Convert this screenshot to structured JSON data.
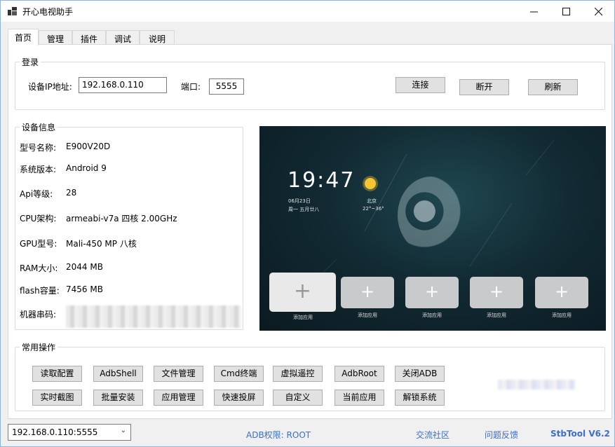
{
  "window": {
    "title": "开心电视助手"
  },
  "icons": {
    "app": "app-icon",
    "minimize": "minimize-icon",
    "maximize": "maximize-icon",
    "close": "close-icon",
    "dropdown": "chevron-down-icon",
    "sun": "sun-icon",
    "plus": "plus-icon"
  },
  "tabs": [
    {
      "label": "首页",
      "active": true
    },
    {
      "label": "管理"
    },
    {
      "label": "插件"
    },
    {
      "label": "调试"
    },
    {
      "label": "说明"
    }
  ],
  "login": {
    "legend": "登录",
    "ip_label": "设备IP地址:",
    "ip_value": "192.168.0.110",
    "port_label": "端口:",
    "port_value": "5555",
    "connect": "连接",
    "disconnect": "断开",
    "refresh": "刷新"
  },
  "device": {
    "legend": "设备信息",
    "rows": [
      {
        "label": "型号名称:",
        "value": "E900V20D"
      },
      {
        "label": "系统版本:",
        "value": "Android 9"
      },
      {
        "label": "Api等级:",
        "value": "28"
      },
      {
        "label": "CPU架构:",
        "value": "armeabi-v7a 四核 2.00GHz"
      },
      {
        "label": "GPU型号:",
        "value": "Mali-450 MP 八核"
      },
      {
        "label": "RAM大小:",
        "value": "2044 MB"
      },
      {
        "label": "flash容量:",
        "value": "7456 MB"
      },
      {
        "label": "机器串码:",
        "value": ""
      }
    ]
  },
  "tv": {
    "time": "19:47",
    "date": "06月23日",
    "weekday": "周一 五月廿八",
    "city": "北京",
    "temp": "22°~36°",
    "tiles": [
      "添加应用",
      "添加应用",
      "添加应用",
      "添加应用",
      "添加应用"
    ]
  },
  "ops": {
    "legend": "常用操作",
    "row1": [
      "读取配置",
      "AdbShell",
      "文件管理",
      "Cmd终端",
      "虚拟遥控",
      "AdbRoot",
      "关闭ADB"
    ],
    "row2": [
      "实时截图",
      "批量安装",
      "应用管理",
      "快速投屏",
      "自定义",
      "当前应用",
      "解锁系统"
    ]
  },
  "status": {
    "device_select": "192.168.0.110:5555",
    "adb_perm": "ADB权限:  ROOT",
    "community": "交流社区",
    "feedback": "问题反馈",
    "version": "StbTool V6.2"
  }
}
